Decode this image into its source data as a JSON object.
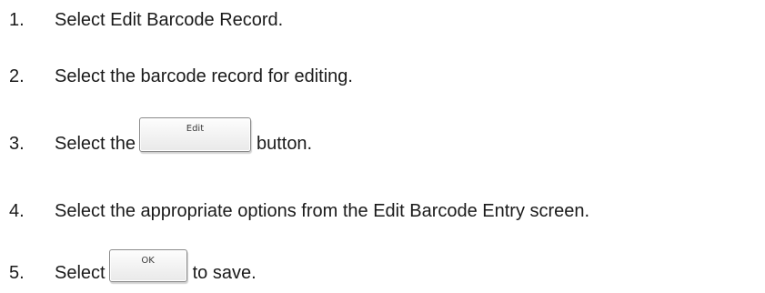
{
  "steps": [
    {
      "number": "1.",
      "text": "Select Edit Barcode Record."
    },
    {
      "number": "2.",
      "text": "Select the barcode record for editing."
    },
    {
      "number": "3.",
      "text_before": "Select the",
      "button_label": "Edit",
      "text_after": "button."
    },
    {
      "number": "4.",
      "text": "Select the appropriate options from the Edit Barcode Entry screen."
    },
    {
      "number": "5.",
      "text_before": "Select",
      "button_label": "OK",
      "text_after": "to save."
    }
  ]
}
